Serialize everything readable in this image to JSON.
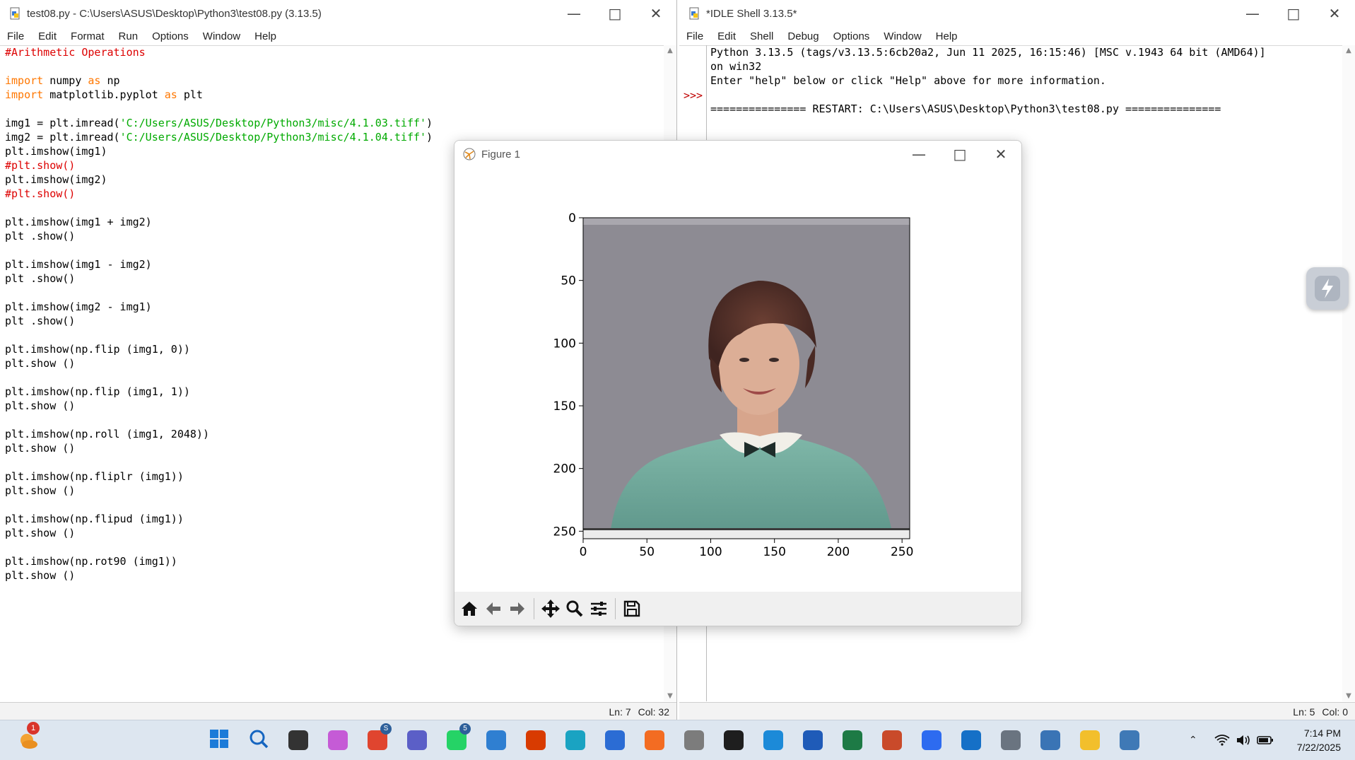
{
  "editor": {
    "title": "test08.py - C:\\Users\\ASUS\\Desktop\\Python3\\test08.py (3.13.5)",
    "menu": [
      "File",
      "Edit",
      "Format",
      "Run",
      "Options",
      "Window",
      "Help"
    ],
    "lines": [
      [
        {
          "t": "#Arithmetic Operations",
          "c": "cmt"
        }
      ],
      [],
      [
        {
          "t": "import",
          "c": "kw"
        },
        {
          "t": " numpy "
        },
        {
          "t": "as",
          "c": "kw"
        },
        {
          "t": " np"
        }
      ],
      [
        {
          "t": "import",
          "c": "kw"
        },
        {
          "t": " matplotlib.pyplot "
        },
        {
          "t": "as",
          "c": "kw"
        },
        {
          "t": " plt"
        }
      ],
      [],
      [
        {
          "t": "img1 = plt.imread("
        },
        {
          "t": "'C:/Users/ASUS/Desktop/Python3/misc/4.1.03.tiff'",
          "c": "str"
        },
        {
          "t": ")"
        }
      ],
      [
        {
          "t": "img2 = plt.imread("
        },
        {
          "t": "'C:/Users/ASUS/Desktop/Python3/misc/4.1.04.tiff'",
          "c": "str"
        },
        {
          "t": ")"
        }
      ],
      [
        {
          "t": "plt.imshow(img1)"
        }
      ],
      [
        {
          "t": "#plt.show()",
          "c": "cmt"
        }
      ],
      [
        {
          "t": "plt.imshow(img2)"
        }
      ],
      [
        {
          "t": "#plt.show()",
          "c": "cmt"
        }
      ],
      [],
      [
        {
          "t": "plt.imshow(img1 + img2)"
        }
      ],
      [
        {
          "t": "plt .show()"
        }
      ],
      [],
      [
        {
          "t": "plt.imshow(img1 - img2)"
        }
      ],
      [
        {
          "t": "plt .show()"
        }
      ],
      [],
      [
        {
          "t": "plt.imshow(img2 - img1)"
        }
      ],
      [
        {
          "t": "plt .show()"
        }
      ],
      [],
      [
        {
          "t": "plt.imshow(np.flip (img1, 0))"
        }
      ],
      [
        {
          "t": "plt.show ()"
        }
      ],
      [],
      [
        {
          "t": "plt.imshow(np.flip (img1, 1))"
        }
      ],
      [
        {
          "t": "plt.show ()"
        }
      ],
      [],
      [
        {
          "t": "plt.imshow(np.roll (img1, 2048))"
        }
      ],
      [
        {
          "t": "plt.show ()"
        }
      ],
      [],
      [
        {
          "t": "plt.imshow(np.fliplr (img1))"
        }
      ],
      [
        {
          "t": "plt.show ()"
        }
      ],
      [],
      [
        {
          "t": "plt.imshow(np.flipud (img1))"
        }
      ],
      [
        {
          "t": "plt.show ()"
        }
      ],
      [],
      [
        {
          "t": "plt.imshow(np.rot90 (img1))"
        }
      ],
      [
        {
          "t": "plt.show ()"
        }
      ]
    ],
    "status": {
      "ln": "Ln: 7",
      "col": "Col: 32"
    }
  },
  "shell": {
    "title": "*IDLE Shell 3.13.5*",
    "menu": [
      "File",
      "Edit",
      "Shell",
      "Debug",
      "Options",
      "Window",
      "Help"
    ],
    "lines": [
      "Python 3.13.5 (tags/v3.13.5:6cb20a2, Jun 11 2025, 16:15:46) [MSC v.1943 64 bit (AMD64)]",
      "on win32",
      "Enter \"help\" below or click \"Help\" above for more information.",
      "",
      "=============== RESTART: C:\\Users\\ASUS\\Desktop\\Python3\\test08.py ==============="
    ],
    "prompt": ">>>",
    "status": {
      "ln": "Ln: 5",
      "col": "Col: 0"
    }
  },
  "figure": {
    "title": "Figure 1",
    "x_ticks": [
      "0",
      "50",
      "100",
      "150",
      "200",
      "250"
    ],
    "y_ticks": [
      "0",
      "50",
      "100",
      "150",
      "200",
      "250"
    ],
    "image_description": "portrait photo"
  },
  "chart_data": {
    "type": "image",
    "xlim": [
      0,
      256
    ],
    "ylim": [
      256,
      0
    ],
    "x_ticks": [
      0,
      50,
      100,
      150,
      200,
      250
    ],
    "y_ticks": [
      0,
      50,
      100,
      150,
      200,
      250
    ]
  },
  "taskbar": {
    "clock_time": "7:14 PM",
    "clock_date": "7/22/2025",
    "notification_badge": "1",
    "chrome_badge": "S",
    "whatsapp_badge": "5",
    "apps": [
      "start",
      "search",
      "task-view",
      "copilot",
      "chrome",
      "teams",
      "whatsapp",
      "photos",
      "office",
      "edge",
      "word-alt",
      "firefox",
      "snipping",
      "terminal",
      "vscode",
      "word",
      "excel",
      "powerpoint",
      "zoom",
      "outlook",
      "settings",
      "python",
      "file-explorer",
      "idle"
    ]
  }
}
